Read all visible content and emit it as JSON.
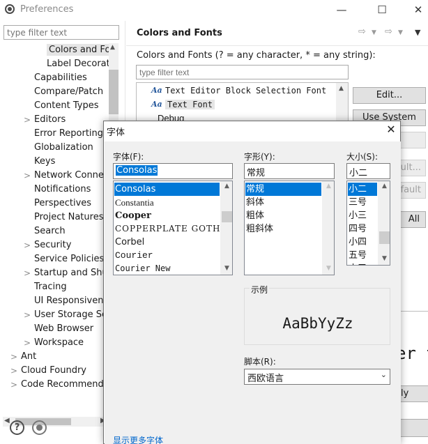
{
  "window": {
    "title": "Preferences"
  },
  "left": {
    "filter_placeholder": "type filter text",
    "tree": [
      {
        "label": "Colors and For",
        "indent": 2,
        "selected": true,
        "expander": ""
      },
      {
        "label": "Label Decoratio",
        "indent": 2,
        "selected": false,
        "expander": ""
      },
      {
        "label": "Capabilities",
        "indent": 1,
        "selected": false,
        "expander": ""
      },
      {
        "label": "Compare/Patch",
        "indent": 1,
        "selected": false,
        "expander": ""
      },
      {
        "label": "Content Types",
        "indent": 1,
        "selected": false,
        "expander": ""
      },
      {
        "label": "Editors",
        "indent": 1,
        "selected": false,
        "expander": ">"
      },
      {
        "label": "Error Reporting",
        "indent": 1,
        "selected": false,
        "expander": ""
      },
      {
        "label": "Globalization",
        "indent": 1,
        "selected": false,
        "expander": ""
      },
      {
        "label": "Keys",
        "indent": 1,
        "selected": false,
        "expander": ""
      },
      {
        "label": "Network Connect",
        "indent": 1,
        "selected": false,
        "expander": ">"
      },
      {
        "label": "Notifications",
        "indent": 1,
        "selected": false,
        "expander": ""
      },
      {
        "label": "Perspectives",
        "indent": 1,
        "selected": false,
        "expander": ""
      },
      {
        "label": "Project Natures",
        "indent": 1,
        "selected": false,
        "expander": ""
      },
      {
        "label": "Search",
        "indent": 1,
        "selected": false,
        "expander": ""
      },
      {
        "label": "Security",
        "indent": 1,
        "selected": false,
        "expander": ">"
      },
      {
        "label": "Service Policies",
        "indent": 1,
        "selected": false,
        "expander": ""
      },
      {
        "label": "Startup and Shutd",
        "indent": 1,
        "selected": false,
        "expander": ">"
      },
      {
        "label": "Tracing",
        "indent": 1,
        "selected": false,
        "expander": ""
      },
      {
        "label": "UI Responsivenes",
        "indent": 1,
        "selected": false,
        "expander": ""
      },
      {
        "label": "User Storage Ser",
        "indent": 1,
        "selected": false,
        "expander": ">"
      },
      {
        "label": "Web Browser",
        "indent": 1,
        "selected": false,
        "expander": ""
      },
      {
        "label": "Workspace",
        "indent": 1,
        "selected": false,
        "expander": ">"
      },
      {
        "label": "Ant",
        "indent": 0,
        "selected": false,
        "expander": ">"
      },
      {
        "label": "Cloud Foundry",
        "indent": 0,
        "selected": false,
        "expander": ">"
      },
      {
        "label": "Code Recommender",
        "indent": 0,
        "selected": false,
        "expander": ">"
      }
    ]
  },
  "right": {
    "title": "Colors and Fonts",
    "description": "Colors and Fonts (? = any character, * = any string):",
    "filter_placeholder": "type filter text",
    "font_items": [
      {
        "label": "Text Editor Block Selection Font",
        "selected": false,
        "icon": "Aa"
      },
      {
        "label": "Text Font",
        "selected": true,
        "icon": "Aa"
      },
      {
        "label": "Debug",
        "selected": false,
        "icon": ""
      }
    ],
    "buttons": {
      "edit": "Edit...",
      "use_system_font": "Use System Font",
      "reset_partial": "ult...",
      "default_partial": "fault",
      "all_partial": "All",
      "apply_partial": "ly"
    },
    "preview_partial": "er t"
  },
  "font_dialog": {
    "title": "字体",
    "font_label": "字体(F):",
    "style_label": "字形(Y):",
    "size_label": "大小(S):",
    "font_value": "Consolas",
    "style_value": "常规",
    "size_value": "小二",
    "fonts": [
      "Consolas",
      "Constantia",
      "Cooper",
      "COPPERPLATE GOTHIC",
      "Corbel",
      "Courier",
      "Courier New"
    ],
    "styles": [
      "常规",
      "斜体",
      "粗体",
      "粗斜体"
    ],
    "sizes": [
      "小二",
      "三号",
      "小三",
      "四号",
      "小四",
      "五号",
      "小五"
    ],
    "sample_title": "示例",
    "sample_text": "AaBbYyZz",
    "script_label": "脚本(R):",
    "script_value": "西欧语言",
    "more_fonts_link": "显示更多字体"
  }
}
